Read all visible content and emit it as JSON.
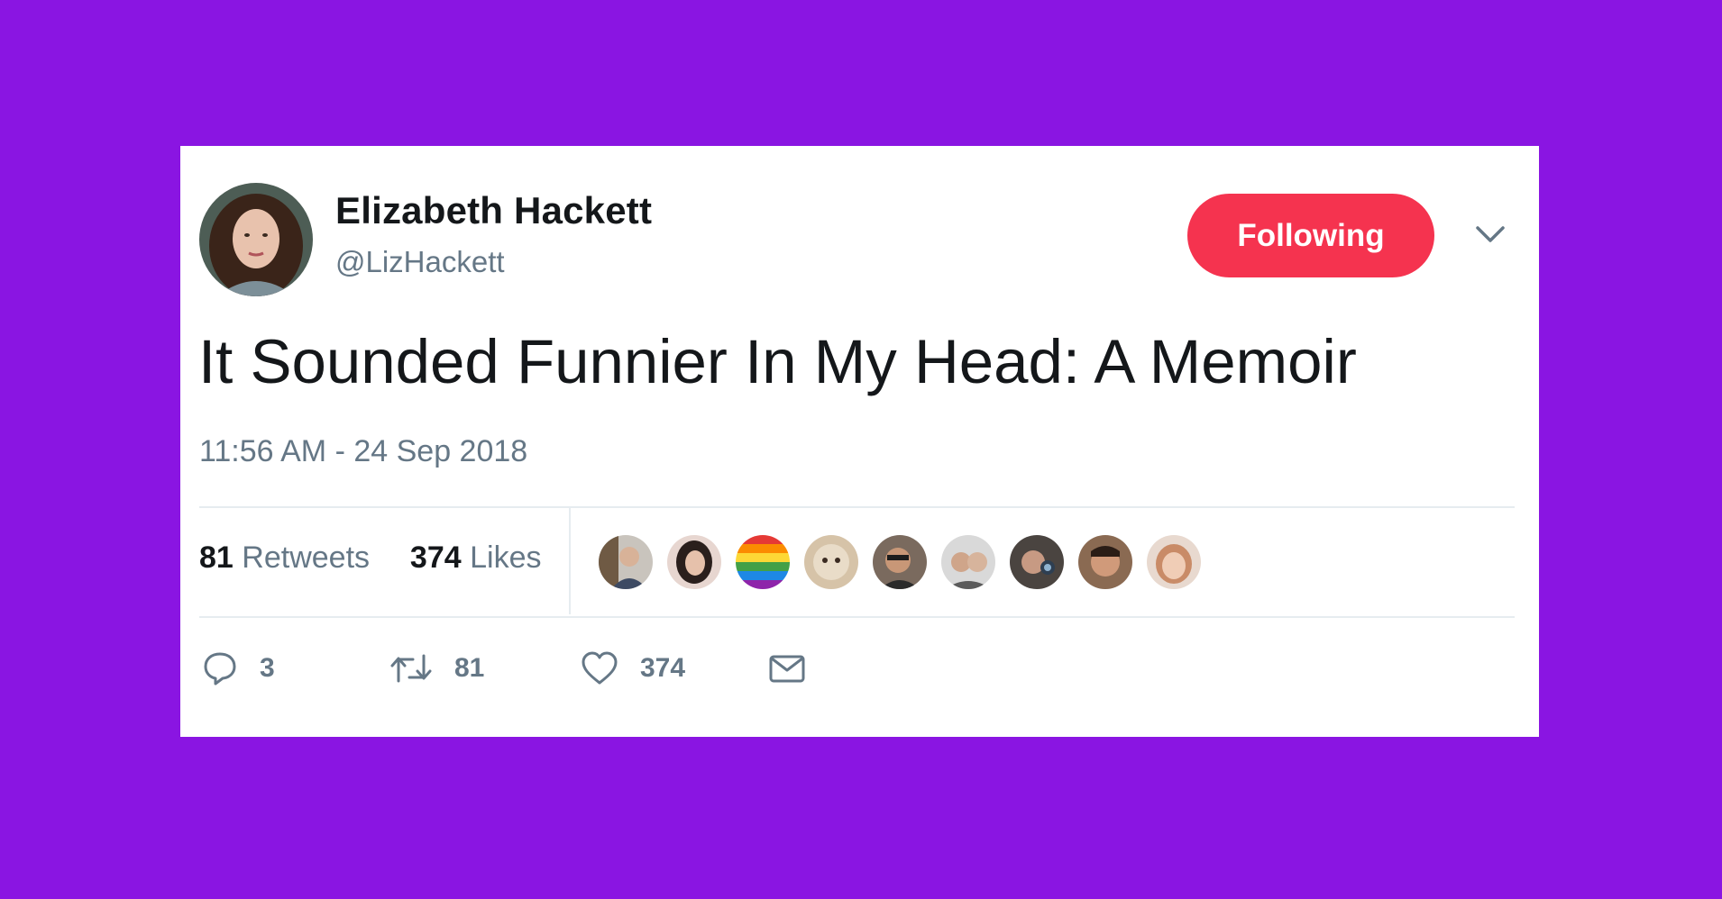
{
  "tweet": {
    "author": {
      "name": "Elizabeth Hackett",
      "handle": "@LizHackett",
      "avatar_icon": "user-avatar-photo"
    },
    "follow_button": {
      "label": "Following",
      "color": "#f5334f"
    },
    "menu_icon": "chevron-down-icon",
    "text": "It Sounded Funnier In My Head: A Memoir",
    "timestamp": "11:56 AM - 24 Sep 2018",
    "stats": {
      "retweets": {
        "count": "81",
        "label": "Retweets"
      },
      "likes": {
        "count": "374",
        "label": "Likes"
      }
    },
    "liker_avatars": [
      "liker-avatar-1",
      "liker-avatar-2",
      "liker-avatar-3",
      "liker-avatar-4",
      "liker-avatar-5",
      "liker-avatar-6",
      "liker-avatar-7",
      "liker-avatar-8",
      "liker-avatar-9"
    ],
    "actions": {
      "reply": {
        "icon": "reply-icon",
        "count": "3"
      },
      "retweet": {
        "icon": "retweet-icon",
        "count": "81"
      },
      "like": {
        "icon": "heart-icon",
        "count": "374"
      },
      "message": {
        "icon": "envelope-icon"
      }
    }
  },
  "colors": {
    "background": "#8a15e2",
    "card": "#ffffff",
    "accent": "#f5334f",
    "text_primary": "#14171a",
    "text_secondary": "#657786"
  }
}
